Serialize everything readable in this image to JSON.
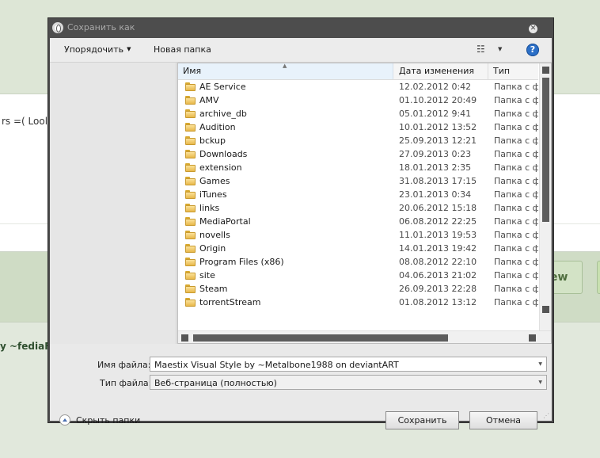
{
  "background": {
    "text_top": "rs =( Lool",
    "text_bottom": "y ~fediaFe",
    "button_label": "ew"
  },
  "dialog": {
    "title": "Сохранить как",
    "toolbar": {
      "organize_label": "Упорядочить",
      "new_folder_label": "Новая папка"
    },
    "columns": {
      "name": "Имя",
      "date": "Дата изменения",
      "type": "Тип"
    },
    "files": [
      {
        "name": "AE Service",
        "date": "12.02.2012 0:42",
        "type": "Папка с файлами"
      },
      {
        "name": "AMV",
        "date": "01.10.2012 20:49",
        "type": "Папка с файлами"
      },
      {
        "name": "archive_db",
        "date": "05.01.2012 9:41",
        "type": "Папка с файлами"
      },
      {
        "name": "Audition",
        "date": "10.01.2012 13:52",
        "type": "Папка с файлами"
      },
      {
        "name": "bckup",
        "date": "25.09.2013 12:21",
        "type": "Папка с файлами"
      },
      {
        "name": "Downloads",
        "date": "27.09.2013 0:23",
        "type": "Папка с файлами"
      },
      {
        "name": "extension",
        "date": "18.01.2013 2:35",
        "type": "Папка с файлами"
      },
      {
        "name": "Games",
        "date": "31.08.2013 17:15",
        "type": "Папка с файлами"
      },
      {
        "name": "iTunes",
        "date": "23.01.2013 0:34",
        "type": "Папка с файлами"
      },
      {
        "name": "links",
        "date": "20.06.2012 15:18",
        "type": "Папка с файлами"
      },
      {
        "name": "MediaPortal",
        "date": "06.08.2012 22:25",
        "type": "Папка с файлами"
      },
      {
        "name": "novells",
        "date": "11.01.2013 19:53",
        "type": "Папка с файлами"
      },
      {
        "name": "Origin",
        "date": "14.01.2013 19:42",
        "type": "Папка с файлами"
      },
      {
        "name": "Program Files (x86)",
        "date": "08.08.2012 22:10",
        "type": "Папка с файлами"
      },
      {
        "name": "site",
        "date": "04.06.2013 21:02",
        "type": "Папка с файлами"
      },
      {
        "name": "Steam",
        "date": "26.09.2013 22:28",
        "type": "Папка с файлами"
      },
      {
        "name": "torrentStream",
        "date": "01.08.2012 13:12",
        "type": "Папка с файлами"
      }
    ],
    "filename_label": "Имя файла:",
    "filename_value": "Maestix Visual Style by ~Metalbone1988 on deviantART",
    "filetype_label": "Тип файла:",
    "filetype_value": "Веб-страница (полностью)",
    "hide_folders_label": "Скрыть папки",
    "save_label": "Сохранить",
    "cancel_label": "Отмена"
  }
}
